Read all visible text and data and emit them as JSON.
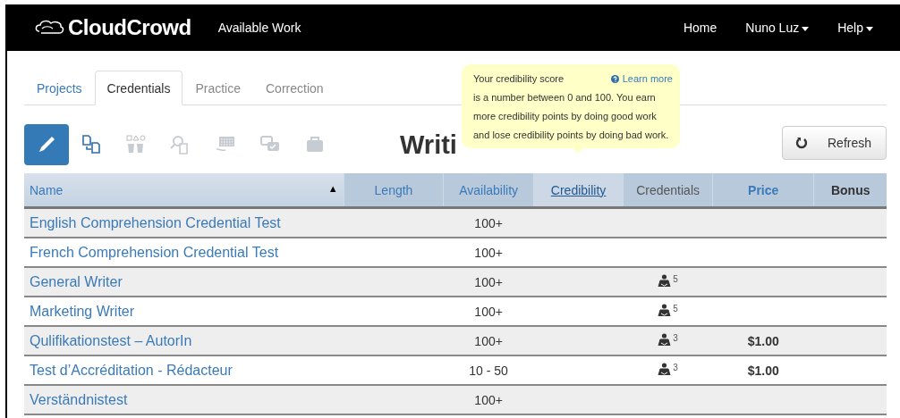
{
  "navbar": {
    "logo": "CloudCrowd",
    "section": "Available Work",
    "links": [
      {
        "label": "Home",
        "dropdown": false
      },
      {
        "label": "Nuno Luz",
        "dropdown": true
      },
      {
        "label": "Help",
        "dropdown": true
      }
    ]
  },
  "tabs": [
    {
      "label": "Projects",
      "selected": false
    },
    {
      "label": "Credentials",
      "selected": true
    },
    {
      "label": "Practice",
      "selected": false
    },
    {
      "label": "Correction",
      "selected": false
    }
  ],
  "toolbar": [
    {
      "kind": "pen",
      "selected": true
    },
    {
      "kind": "documents",
      "selected": false
    },
    {
      "kind": "shapes",
      "selected": false
    },
    {
      "kind": "search",
      "selected": false
    },
    {
      "kind": "keyboard",
      "selected": false
    },
    {
      "kind": "chat",
      "selected": false
    },
    {
      "kind": "briefcase",
      "selected": false
    }
  ],
  "heading": "Writi",
  "tooltip": {
    "title": "Your credibility score",
    "text": "is a number between 0 and 100. You earn more credibility points by doing good work and lose credibility points by doing bad work.",
    "link": "Learn more"
  },
  "refresh_button": "Refresh",
  "table": {
    "columns": [
      {
        "label": "Name",
        "kind": "plain-link",
        "sort": "▲"
      },
      {
        "label": "Length",
        "kind": "link"
      },
      {
        "label": "Availability",
        "kind": "link"
      },
      {
        "label": "Credibility",
        "kind": "active"
      },
      {
        "label": "Credentials",
        "kind": "plain"
      },
      {
        "label": "Price",
        "kind": "bold-link"
      },
      {
        "label": "Bonus",
        "kind": "bold"
      }
    ],
    "rows": [
      {
        "name": "English Comprehension Credential Test",
        "availability": "100+"
      },
      {
        "name": "French Comprehension Credential Test",
        "availability": "100+"
      },
      {
        "name": "General Writer",
        "availability": "100+",
        "credentials": "5"
      },
      {
        "name": "Marketing Writer",
        "availability": "100+",
        "credentials": "5"
      },
      {
        "name": "Qulifikationstest – AutorIn",
        "availability": "100+",
        "credentials": "3",
        "price": "$1.00"
      },
      {
        "name": "Test d’Accréditation - Rédacteur",
        "availability": "10 - 50",
        "credentials": "3",
        "price": "$1.00"
      },
      {
        "name": "Verständnistest",
        "availability": "100+"
      }
    ]
  }
}
